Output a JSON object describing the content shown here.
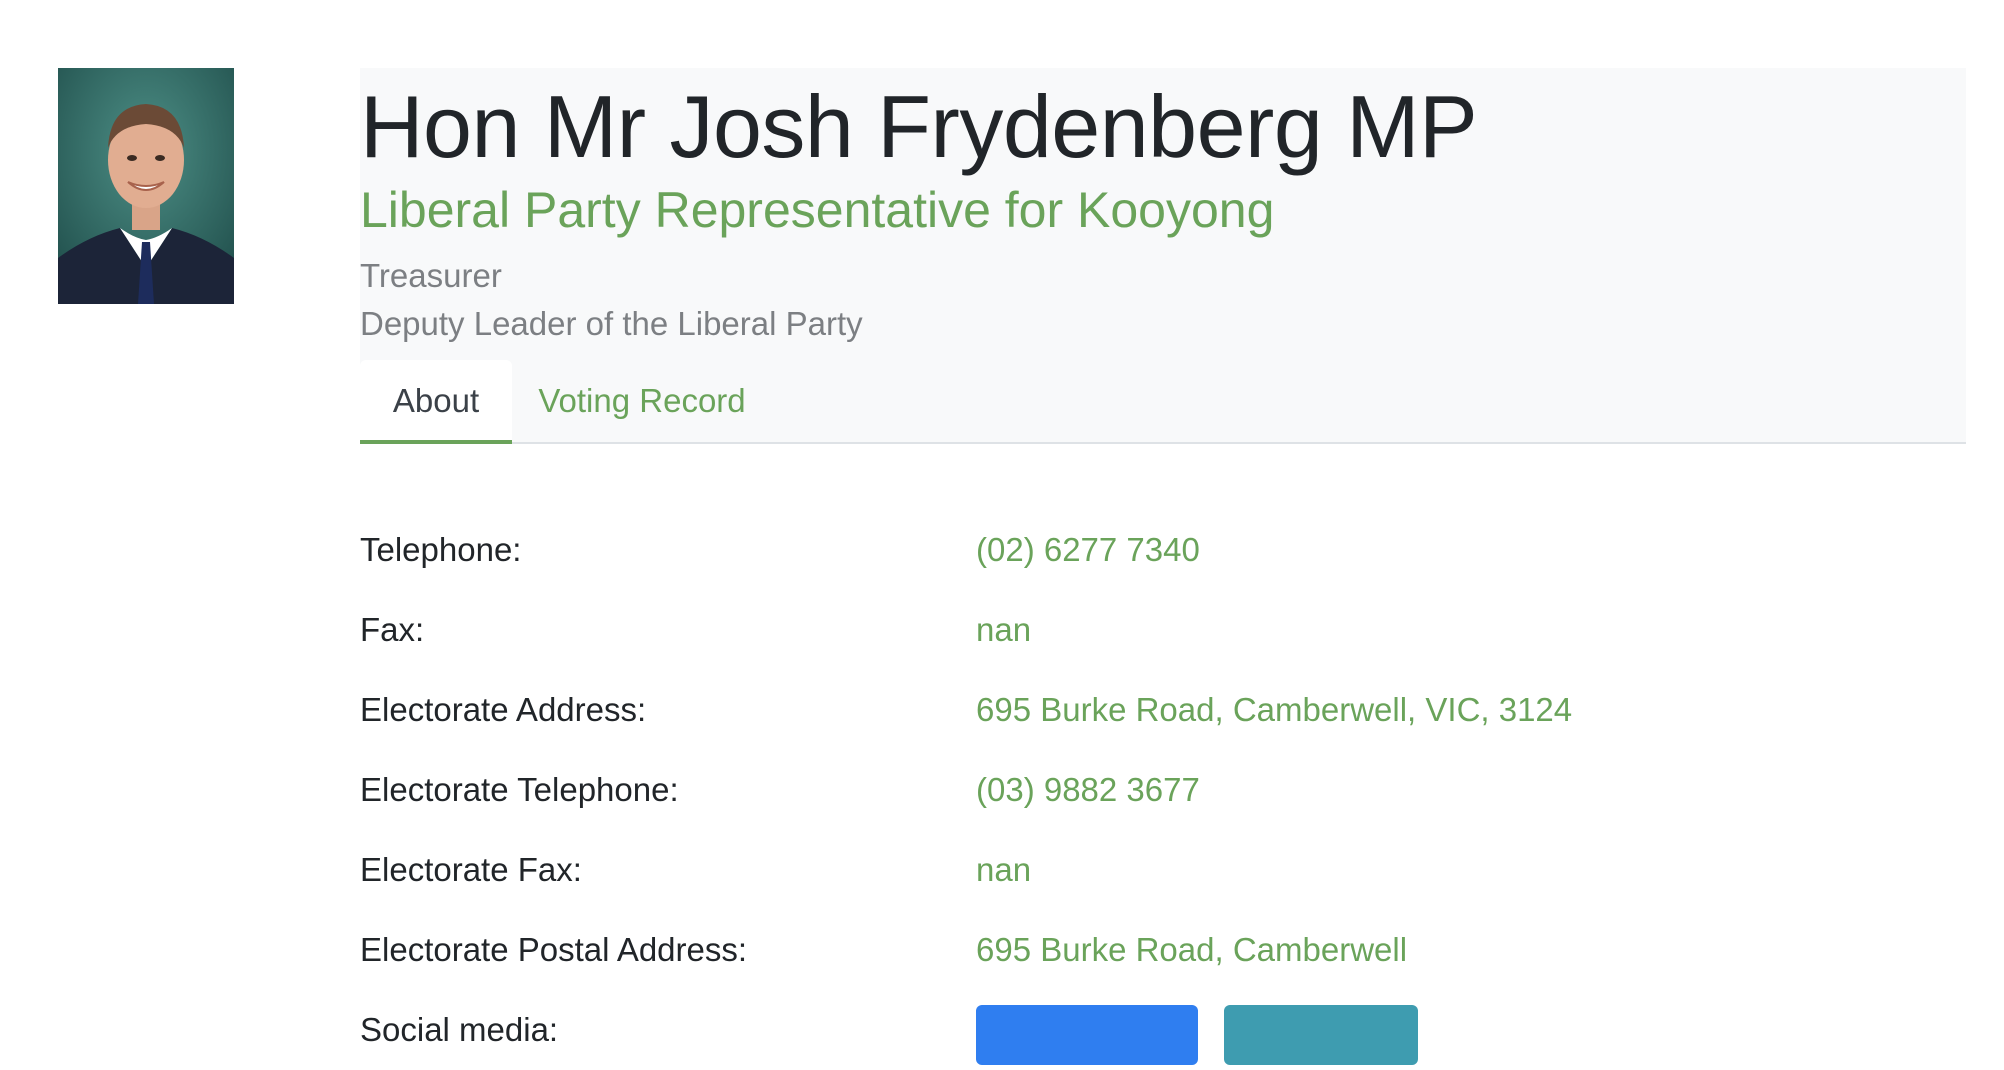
{
  "member": {
    "name": "Hon Mr Josh Frydenberg MP",
    "subtitle": "Liberal Party Representative for Kooyong",
    "roles": [
      "Treasurer",
      "Deputy Leader of the Liberal Party"
    ]
  },
  "tabs": [
    {
      "label": "About",
      "active": true
    },
    {
      "label": "Voting Record",
      "active": false
    }
  ],
  "contact": [
    {
      "label": "Telephone:",
      "value": "(02) 6277 7340"
    },
    {
      "label": "Fax:",
      "value": "nan"
    },
    {
      "label": "Electorate Address:",
      "value": "695 Burke Road, Camberwell, VIC, 3124"
    },
    {
      "label": "Electorate Telephone:",
      "value": "(03) 9882 3677"
    },
    {
      "label": "Electorate Fax:",
      "value": "nan"
    },
    {
      "label": "Electorate Postal Address:",
      "value": "695 Burke Road, Camberwell"
    },
    {
      "label": "Social media:",
      "value": ""
    }
  ],
  "colors": {
    "accent": "#6aa35a",
    "header_bg": "#f8f9fa",
    "button_primary": "#2f7ef0",
    "button_secondary": "#3e9cb0"
  }
}
